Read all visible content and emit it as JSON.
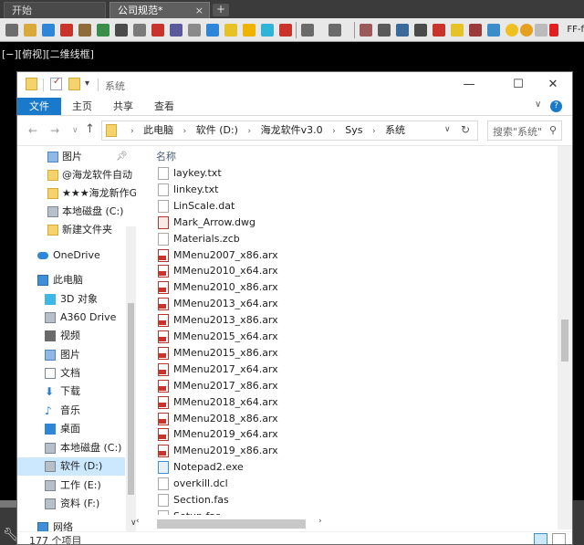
{
  "cad": {
    "tabs": [
      {
        "label": "开始"
      },
      {
        "label": "公司规范*"
      }
    ],
    "active_tab_close": "×",
    "add_tab": "+",
    "ff_label": "FF-f",
    "viewport_label": "[−][俯视][二维线框]"
  },
  "explorer": {
    "title": "系统",
    "window_buttons": {
      "minimize": "—",
      "maximize": "☐",
      "close": "✕"
    },
    "ribbon_tabs": [
      "文件",
      "主页",
      "共享",
      "查看"
    ],
    "ribbon_expand": "∨",
    "help": "?",
    "nav": {
      "back": "←",
      "forward": "→",
      "recent": "∨",
      "up": "↑"
    },
    "breadcrumb": [
      "此电脑",
      "软件 (D:)",
      "海龙软件v3.0",
      "Sys",
      "系统"
    ],
    "address_dropdown": "∨",
    "refresh": "↻",
    "search_placeholder": "搜索\"系统\"",
    "search_icon": "⚲",
    "column_name": "名称",
    "nav_pane": [
      {
        "label": "图片",
        "pinned": true
      },
      {
        "label": "@海龙软件自动"
      },
      {
        "label": "★★★海龙新作G"
      },
      {
        "label": "本地磁盘 (C:)"
      },
      {
        "label": "新建文件夹"
      },
      {
        "label": "OneDrive"
      },
      {
        "label": "此电脑"
      },
      {
        "label": "3D 对象"
      },
      {
        "label": "A360 Drive"
      },
      {
        "label": "视频"
      },
      {
        "label": "图片"
      },
      {
        "label": "文档"
      },
      {
        "label": "下载"
      },
      {
        "label": "音乐"
      },
      {
        "label": "桌面"
      },
      {
        "label": "本地磁盘 (C:)"
      },
      {
        "label": "软件 (D:)",
        "selected": true
      },
      {
        "label": "工作 (E:)"
      },
      {
        "label": "资料 (F:)"
      },
      {
        "label": "网络"
      }
    ],
    "files": [
      {
        "name": "laykey.txt",
        "type": "txt"
      },
      {
        "name": "linkey.txt",
        "type": "txt"
      },
      {
        "name": "LinScale.dat",
        "type": "dat"
      },
      {
        "name": "Mark_Arrow.dwg",
        "type": "dwg"
      },
      {
        "name": "Materials.zcb",
        "type": "zcb"
      },
      {
        "name": "MMenu2007_x86.arx",
        "type": "arx"
      },
      {
        "name": "MMenu2010_x64.arx",
        "type": "arx"
      },
      {
        "name": "MMenu2010_x86.arx",
        "type": "arx"
      },
      {
        "name": "MMenu2013_x64.arx",
        "type": "arx"
      },
      {
        "name": "MMenu2013_x86.arx",
        "type": "arx"
      },
      {
        "name": "MMenu2015_x64.arx",
        "type": "arx"
      },
      {
        "name": "MMenu2015_x86.arx",
        "type": "arx"
      },
      {
        "name": "MMenu2017_x64.arx",
        "type": "arx"
      },
      {
        "name": "MMenu2017_x86.arx",
        "type": "arx"
      },
      {
        "name": "MMenu2018_x64.arx",
        "type": "arx"
      },
      {
        "name": "MMenu2018_x86.arx",
        "type": "arx"
      },
      {
        "name": "MMenu2019_x64.arx",
        "type": "arx"
      },
      {
        "name": "MMenu2019_x86.arx",
        "type": "arx"
      },
      {
        "name": "Notepad2.exe",
        "type": "exe"
      },
      {
        "name": "overkill.dcl",
        "type": "dcl"
      },
      {
        "name": "Section.fas",
        "type": "fas"
      },
      {
        "name": "Setup.fas",
        "type": "fas"
      }
    ],
    "status_count": "177 个项目"
  }
}
